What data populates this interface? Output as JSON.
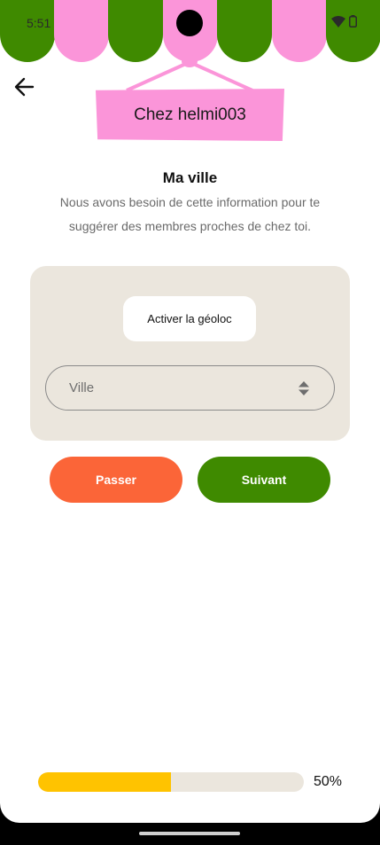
{
  "status_bar": {
    "time": "5:51",
    "wifi_icon": "wifi-icon",
    "battery_icon": "battery-icon"
  },
  "header": {
    "back_icon": "arrow-left-icon",
    "sign_text": "Chez helmi003"
  },
  "main": {
    "title": "Ma ville",
    "subtitle": "Nous avons besoin de cette information pour te suggérer des membres proches de chez toi.",
    "geoloc_button": "Activer la géoloc",
    "city_select": {
      "placeholder": "Ville",
      "icon": "select-arrows-icon"
    }
  },
  "actions": {
    "skip_label": "Passer",
    "next_label": "Suivant"
  },
  "progress": {
    "value": 0.5,
    "label": "50%"
  },
  "colors": {
    "green": "#3f8a00",
    "pink": "#fb95d9",
    "orange": "#fb6538",
    "yellow": "#ffc300",
    "beige": "#ebe6dd"
  }
}
